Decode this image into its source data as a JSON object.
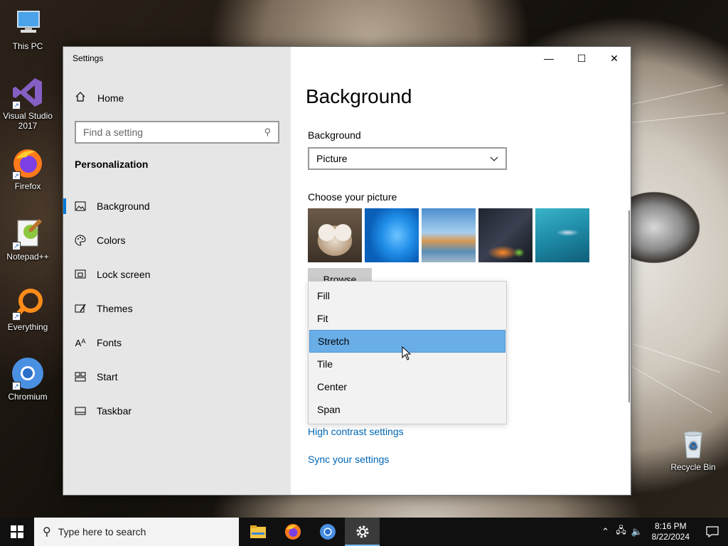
{
  "desktop": {
    "icons": [
      {
        "label": "This PC",
        "icon": "computer-icon"
      },
      {
        "label": "Visual Studio\n2017",
        "icon": "visual-studio-icon"
      },
      {
        "label": "Firefox",
        "icon": "firefox-icon"
      },
      {
        "label": "Notepad++",
        "icon": "notepadpp-icon"
      },
      {
        "label": "Everything",
        "icon": "everything-icon"
      },
      {
        "label": "Chromium",
        "icon": "chromium-icon"
      },
      {
        "label": "Recycle Bin",
        "icon": "recycle-bin-icon"
      }
    ]
  },
  "window": {
    "title": "Settings",
    "caption": {
      "minimize": "—",
      "maximize": "☐",
      "close": "✕"
    }
  },
  "sidebar": {
    "home": "Home",
    "search_placeholder": "Find a setting",
    "section": "Personalization",
    "items": [
      {
        "label": "Background",
        "icon": "picture-icon",
        "active": true
      },
      {
        "label": "Colors",
        "icon": "palette-icon"
      },
      {
        "label": "Lock screen",
        "icon": "lock-screen-icon"
      },
      {
        "label": "Themes",
        "icon": "themes-icon"
      },
      {
        "label": "Fonts",
        "icon": "fonts-icon"
      },
      {
        "label": "Start",
        "icon": "start-icon"
      },
      {
        "label": "Taskbar",
        "icon": "taskbar-icon"
      }
    ]
  },
  "main": {
    "title": "Background",
    "background_label": "Background",
    "background_value": "Picture",
    "choose_label": "Choose your picture",
    "browse_label": "Browse",
    "fit_options": [
      "Fill",
      "Fit",
      "Stretch",
      "Tile",
      "Center",
      "Span"
    ],
    "fit_selected": "Stretch",
    "links": [
      "High contrast settings",
      "Sync your settings"
    ]
  },
  "taskbar": {
    "search_placeholder": "Type here to search",
    "apps": [
      "file-explorer-icon",
      "firefox-icon",
      "chromium-icon",
      "settings-icon"
    ],
    "time": "8:16 PM",
    "date": "8/22/2024"
  },
  "colors": {
    "accent": "#0078d7",
    "selection": "#6aaee8",
    "link": "#0066b4"
  }
}
